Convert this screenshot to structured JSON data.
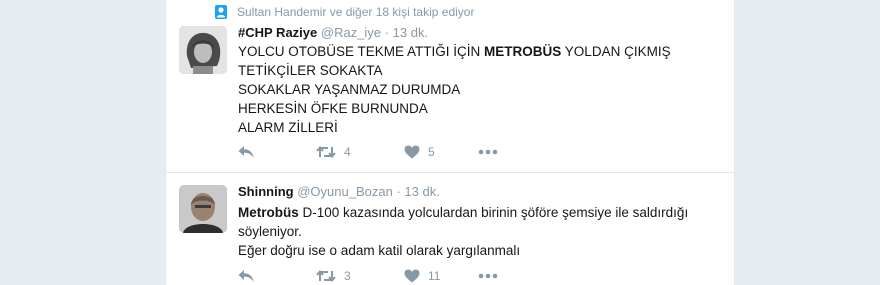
{
  "context": {
    "text": "Sultan Handemir ve diğer 18 kişi takip ediyor"
  },
  "tweets": [
    {
      "fullname": "#CHP Raziye",
      "username": "@Raz_iye",
      "timesep": "·",
      "timestamp": "13 dk.",
      "lines": [
        {
          "pre": "YOLCU OTOBÜSE TEKME ATTIĞI İÇİN ",
          "bold": "METROBÜS",
          "post": " YOLDAN ÇIKMIŞ"
        },
        {
          "pre": "TETİKÇİLER SOKAKTA",
          "bold": "",
          "post": ""
        },
        {
          "pre": "SOKAKLAR YAŞANMAZ DURUMDA",
          "bold": "",
          "post": ""
        },
        {
          "pre": "HERKESİN ÖFKE BURNUNDA",
          "bold": "",
          "post": ""
        },
        {
          "pre": "ALARM ZİLLERİ",
          "bold": "",
          "post": ""
        }
      ],
      "retweets": "4",
      "likes": "5"
    },
    {
      "fullname": "Shinning",
      "username": "@Oyunu_Bozan",
      "timesep": "·",
      "timestamp": "13 dk.",
      "lines": [
        {
          "pre": "",
          "bold": "Metrobüs",
          "post": " D-100 kazasında yolculardan birinin şöföre şemsiye ile saldırdığı"
        },
        {
          "pre": "söyleniyor.",
          "bold": "",
          "post": ""
        },
        {
          "pre": "Eğer doğru ise o adam katil olarak yargılanmalı",
          "bold": "",
          "post": ""
        }
      ],
      "retweets": "3",
      "likes": "11"
    }
  ],
  "colors": {
    "muted": "#8899a6",
    "text": "#14171a",
    "border": "#e1e8ed",
    "background": "#e6ecf0",
    "accent": "#1da1f2"
  },
  "icons": {
    "context": "person-follow-icon",
    "reply": "reply-icon",
    "retweet": "retweet-icon",
    "like": "heart-icon",
    "more": "more-dots-icon"
  }
}
